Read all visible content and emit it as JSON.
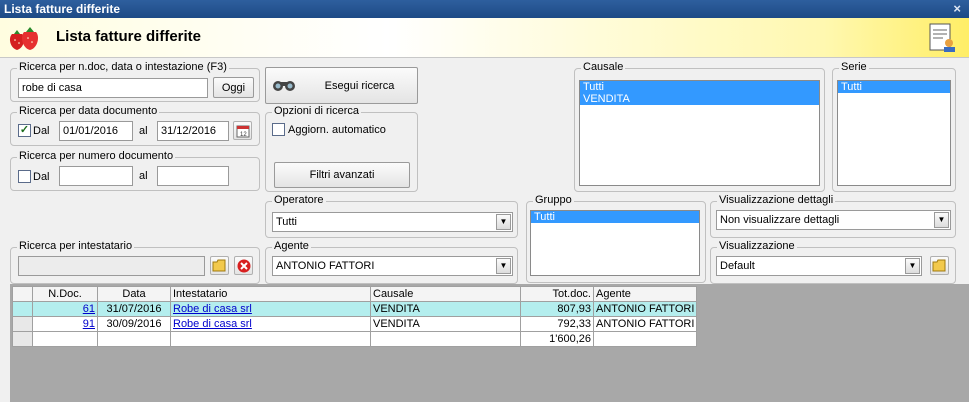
{
  "window": {
    "title": "Lista fatture differite",
    "close_glyph": "×"
  },
  "header": {
    "title": "Lista fatture differite"
  },
  "search_text": {
    "legend": "Ricerca per n.doc, data o intestazione (F3)",
    "value": "robe di casa",
    "button": "Oggi"
  },
  "execute_search": {
    "label": "Esegui ricerca"
  },
  "search_by_date": {
    "legend": "Ricerca per data documento",
    "checked": true,
    "from_label": "Dal",
    "from_value": "01/01/2016",
    "to_label": "al",
    "to_value": "31/12/2016"
  },
  "search_options": {
    "legend": "Opzioni di ricerca",
    "auto_update_label": "Aggiorn. automatico",
    "auto_update_checked": false,
    "advanced_filters": "Filtri avanzati"
  },
  "search_by_number": {
    "legend": "Ricerca per numero documento",
    "checked": false,
    "from_label": "Dal",
    "from_value": "",
    "to_label": "al",
    "to_value": ""
  },
  "causale": {
    "legend": "Causale",
    "items": [
      "Tutti",
      "VENDITA"
    ]
  },
  "serie": {
    "legend": "Serie",
    "items": [
      "Tutti"
    ]
  },
  "operatore": {
    "legend": "Operatore",
    "value": "Tutti"
  },
  "gruppo": {
    "legend": "Gruppo",
    "items": [
      "Tutti"
    ]
  },
  "visualizzazione_dettagli": {
    "legend": "Visualizzazione dettagli",
    "value": "Non visualizzare dettagli"
  },
  "intestatario": {
    "legend": "Ricerca per intestatario",
    "value": ""
  },
  "agente": {
    "legend": "Agente",
    "value": "ANTONIO FATTORI"
  },
  "visualizzazione": {
    "legend": "Visualizzazione",
    "value": "Default"
  },
  "table": {
    "headers": [
      "N.Doc.",
      "Data",
      "Intestatario",
      "Causale",
      "Tot.doc.",
      "Agente"
    ],
    "rows": [
      {
        "ndoc": "61",
        "data": "31/07/2016",
        "intestatario": "Robe di casa srl",
        "causale": "VENDITA",
        "tot": "807,93",
        "agente": "ANTONIO FATTORI"
      },
      {
        "ndoc": "91",
        "data": "30/09/2016",
        "intestatario": "Robe di casa srl",
        "causale": "VENDITA",
        "tot": "792,33",
        "agente": "ANTONIO FATTORI"
      }
    ],
    "total": "1'600,26"
  },
  "colors": {
    "titlebar": "#1d4a85",
    "selection": "#3399ff",
    "highlight_row": "#b4eeee"
  }
}
